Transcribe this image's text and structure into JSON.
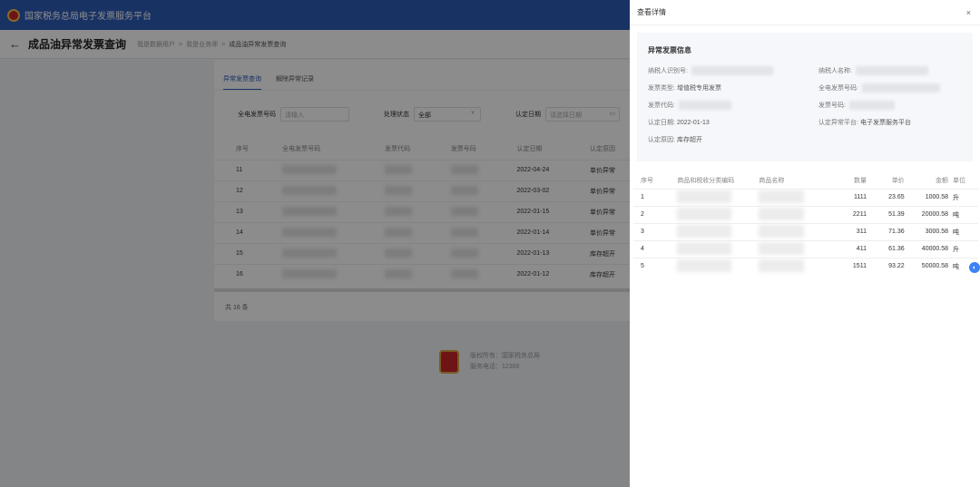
{
  "app": {
    "title": "国家税务总局电子发票服务平台",
    "page_title": "成品油异常发票查询",
    "breadcrumb": [
      "我是数据用户",
      "我是业务师",
      "成品油异常发票查询"
    ]
  },
  "main": {
    "tabs": [
      "异常发票查询",
      "解除异常记录"
    ],
    "filters": {
      "invoice_no_label": "全电发票号码",
      "invoice_no_placeholder": "请输入",
      "status_label": "处理状态",
      "status_value": "全部",
      "date_label": "认定日期",
      "date_placeholder": "请选择日期"
    },
    "table": {
      "columns": [
        "序号",
        "全电发票号码",
        "发票代码",
        "发票号码",
        "认定日期",
        "认定原因"
      ],
      "rows": [
        {
          "seq": "11",
          "date": "2022-04-24",
          "reason": "单价异常"
        },
        {
          "seq": "12",
          "date": "2022-03-02",
          "reason": "单价异常"
        },
        {
          "seq": "13",
          "date": "2022-01-15",
          "reason": "单价异常"
        },
        {
          "seq": "14",
          "date": "2022-01-14",
          "reason": "单价异常"
        },
        {
          "seq": "15",
          "date": "2022-01-13",
          "reason": "库存超开"
        },
        {
          "seq": "16",
          "date": "2022-01-12",
          "reason": "库存超开"
        }
      ]
    },
    "total": "共 16 条"
  },
  "footer": {
    "line1": "版权所有：国家税务总局",
    "line2": "服务电话：12366"
  },
  "drawer": {
    "title": "查看详情",
    "close": "×",
    "section_title": "异常发票信息",
    "fields": {
      "taxpayer_id_label": "纳税人识别号:",
      "taxpayer_name_label": "纳税人名称:",
      "invoice_type_label": "发票类型:",
      "invoice_type_value": "增值税专用发票",
      "einvoice_no_label": "全电发票号码:",
      "invoice_code_label": "发票代码:",
      "invoice_number_label": "发票号码:",
      "date_label": "认定日期:",
      "date_value": "2022-01-13",
      "platform_label": "认定异常平台:",
      "platform_value": "电子发票服务平台",
      "reason_label": "认定原因:",
      "reason_value": "库存超开"
    },
    "table": {
      "columns": [
        "序号",
        "商品和税收分类编码",
        "商品名称",
        "数量",
        "单价",
        "金额",
        "单位"
      ],
      "rows": [
        {
          "seq": "1",
          "qty": "1111",
          "price": "23.65",
          "amount": "1000.58",
          "unit": "升"
        },
        {
          "seq": "2",
          "qty": "2211",
          "price": "51.39",
          "amount": "20000.58",
          "unit": "吨"
        },
        {
          "seq": "3",
          "qty": "311",
          "price": "71.36",
          "amount": "3000.58",
          "unit": "吨"
        },
        {
          "seq": "4",
          "qty": "411",
          "price": "61.36",
          "amount": "40000.58",
          "unit": "升"
        },
        {
          "seq": "5",
          "qty": "1511",
          "price": "93.22",
          "amount": "50000.58",
          "unit": "吨"
        }
      ]
    }
  },
  "colors": {
    "brand": "#2f5bb7",
    "accent": "#3b82f6"
  },
  "icons": {
    "back": "←",
    "calendar": "📅",
    "help": "headset-icon"
  }
}
